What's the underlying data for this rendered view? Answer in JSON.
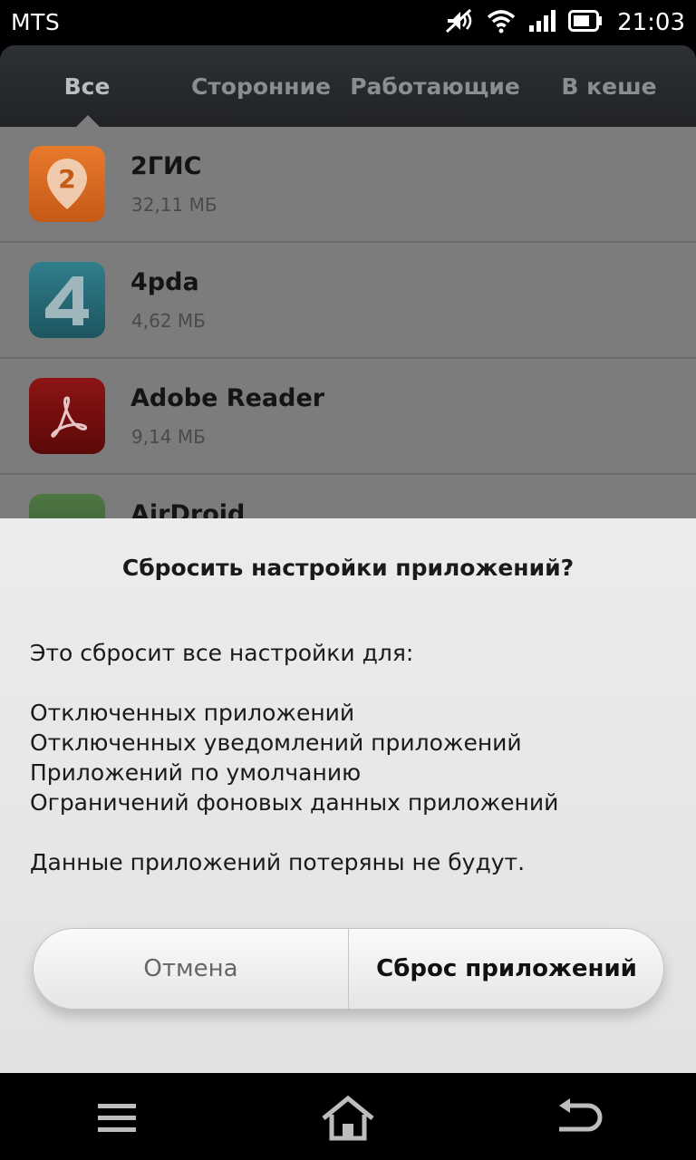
{
  "status_bar": {
    "carrier": "MTS",
    "time": "21:03",
    "icons": [
      "mute-icon",
      "wifi-icon",
      "signal-icon",
      "battery-icon"
    ]
  },
  "tabs": [
    {
      "label": "Все",
      "active": true
    },
    {
      "label": "Сторонние",
      "active": false
    },
    {
      "label": "Работающие",
      "active": false
    },
    {
      "label": "В кеше",
      "active": false
    }
  ],
  "apps": [
    {
      "name": "2ГИС",
      "size": "32,11 МБ",
      "icon": "2gis-icon",
      "color": "#d2671f"
    },
    {
      "name": "4pda",
      "size": "4,62 МБ",
      "icon": "4pda-icon",
      "color": "#1f5a66"
    },
    {
      "name": "Adobe Reader",
      "size": "9,14 МБ",
      "icon": "adobe-reader-icon",
      "color": "#6b0c0c"
    },
    {
      "name": "AirDroid",
      "size": "",
      "icon": "airdroid-icon",
      "color": "#44663a"
    }
  ],
  "dialog": {
    "title": "Сбросить настройки приложений?",
    "intro": "Это сбросит все настройки для:",
    "items": [
      "Отключенных приложений",
      "Отключенных уведомлений приложений",
      "Приложений по умолчанию",
      "Ограничений фоновых данных приложений"
    ],
    "note": "Данные приложений потеряны не будут.",
    "cancel_label": "Отмена",
    "confirm_label": "Сброс приложений"
  },
  "nav_bar": {
    "icons": [
      "menu-icon",
      "home-icon",
      "back-icon"
    ]
  }
}
